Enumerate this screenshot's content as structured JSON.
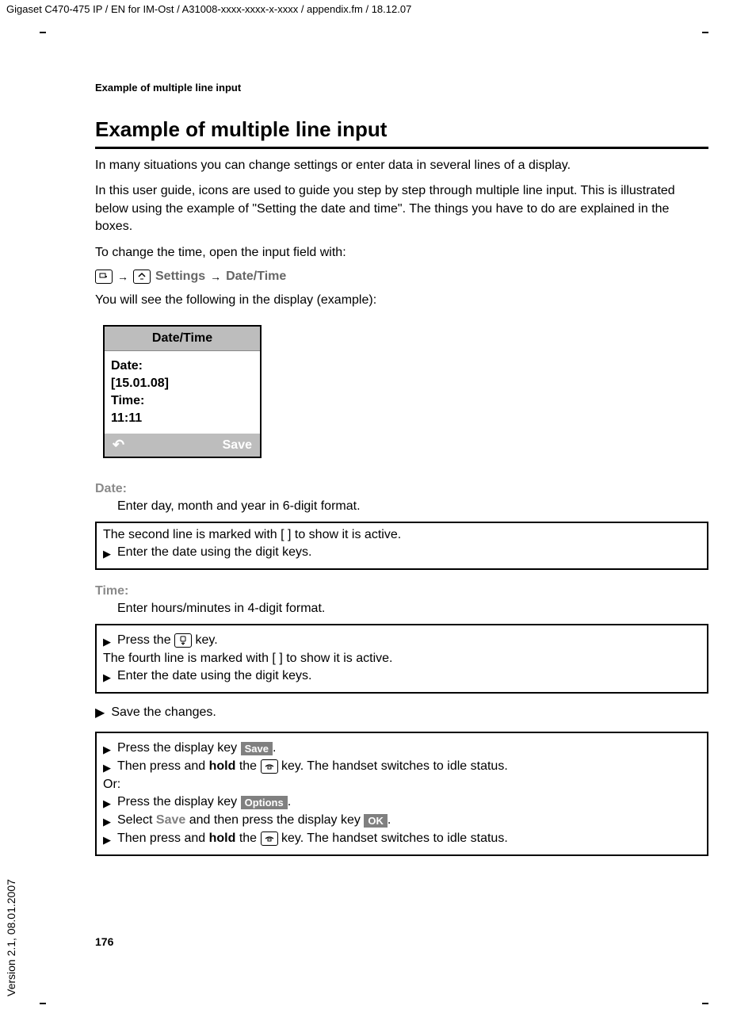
{
  "meta": {
    "header_path": "Gigaset C470-475 IP / EN for IM-Ost / A31008-xxxx-xxxx-x-xxxx / appendix.fm / 18.12.07",
    "running_head": "Example of multiple line input",
    "page_number": "176",
    "version_side": "Version 2.1, 08.01.2007"
  },
  "title": "Example of multiple line input",
  "para1": "In many situations you can change settings or enter data in several lines of a display.",
  "para2": "In this user guide, icons are used to guide you step by step through multiple line input. This is illustrated below using the example of \"Setting the date and time\". The things you have to do are explained in the boxes.",
  "para3": "To change the time, open the input field with:",
  "nav": {
    "settings": "Settings",
    "datetime": "Date/Time"
  },
  "para4": "You will see the following in the display (example):",
  "phone": {
    "title": "Date/Time",
    "row1": "Date:",
    "row2": "[15.01.08]",
    "row3": "Time:",
    "row4": "11:11",
    "back_glyph": "↶",
    "save": "Save"
  },
  "date_section": {
    "label": "Date:",
    "desc": "Enter day, month and year in 6-digit format."
  },
  "box1": {
    "line1": "The second line is marked with [  ] to show it is active.",
    "step1": "Enter the date using the digit keys."
  },
  "time_section": {
    "label": "Time:",
    "desc": "Enter hours/minutes in 4-digit format."
  },
  "box2": {
    "step1_pre": "Press the ",
    "step1_post": " key.",
    "line2": "The fourth line is marked with [  ] to show it is active.",
    "step2": "Enter the date using the digit keys."
  },
  "save_step": "Save the changes.",
  "box3": {
    "s1_pre": "Press the display key ",
    "s1_key": "Save",
    "s1_post": ".",
    "s2_pre": "Then press and ",
    "hold": "hold",
    "s2_mid": " the ",
    "s2_post": " key. The handset switches to idle status.",
    "or": "Or:",
    "s3_pre": "Press the display key ",
    "s3_key": "Options",
    "s3_post": ".",
    "s4_pre": "Select ",
    "s4_save": "Save",
    "s4_mid": " and then press the display key ",
    "s4_key": "OK",
    "s4_post": ".",
    "s5_pre": "Then press and ",
    "s5_mid": " the ",
    "s5_post": " key. The handset switches to idle status."
  }
}
